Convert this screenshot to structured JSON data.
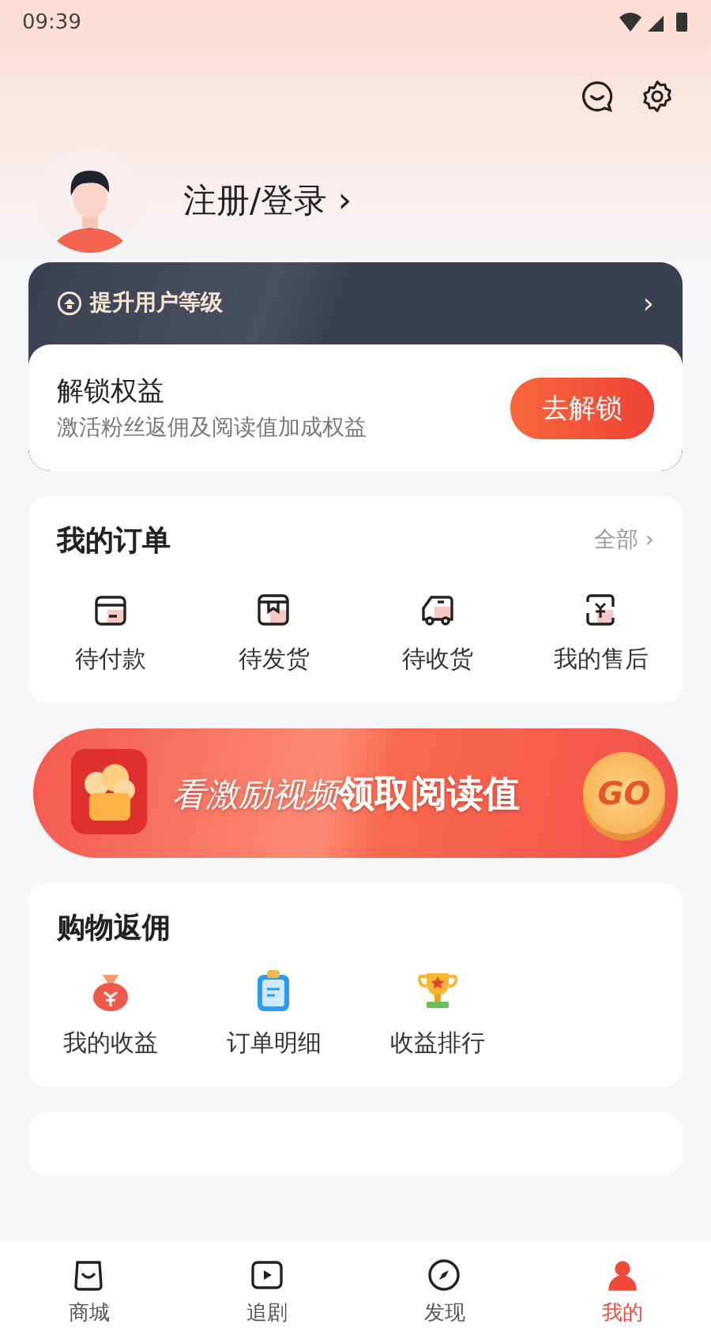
{
  "status_bar": {
    "time": "09:39"
  },
  "profile": {
    "login": "注册/登录",
    "chevron": "›"
  },
  "level_card": {
    "title": "提升用户等级",
    "chevron": "›",
    "unlock_title": "解锁权益",
    "unlock_desc": "激活粉丝返佣及阅读值加成权益",
    "unlock_button": "去解锁"
  },
  "orders": {
    "title": "我的订单",
    "all": "全部",
    "chevron": "›",
    "items": [
      {
        "label": "待付款",
        "kind": "card"
      },
      {
        "label": "待发货",
        "kind": "box"
      },
      {
        "label": "待收货",
        "kind": "truck"
      },
      {
        "label": "我的售后",
        "kind": "refund"
      }
    ]
  },
  "banner": {
    "text_light": "看激励视频",
    "text_bold": "领取阅读值",
    "go": "GO"
  },
  "rebate": {
    "title": "购物返佣",
    "items": [
      {
        "label": "我的收益",
        "kind": "bag"
      },
      {
        "label": "订单明细",
        "kind": "clipboard"
      },
      {
        "label": "收益排行",
        "kind": "trophy"
      }
    ]
  },
  "bottom_nav": [
    {
      "label": "商城",
      "kind": "shop",
      "selected": false
    },
    {
      "label": "追剧",
      "kind": "play",
      "selected": false
    },
    {
      "label": "发现",
      "kind": "compass",
      "selected": false
    },
    {
      "label": "我的",
      "kind": "user",
      "selected": true
    }
  ]
}
